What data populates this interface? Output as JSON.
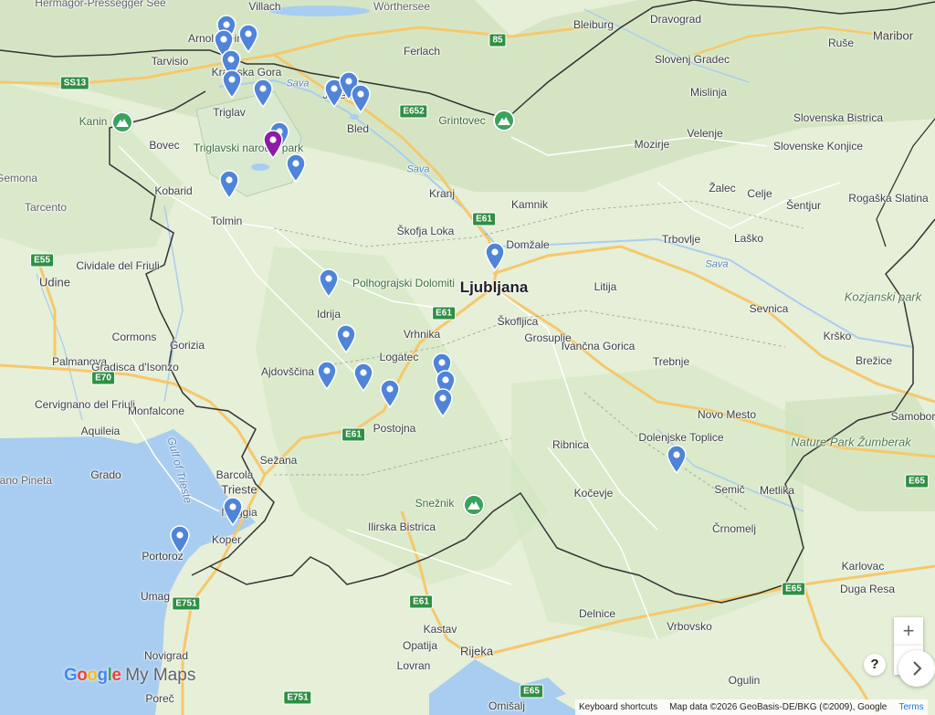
{
  "colors": {
    "land": "#e6efd8",
    "forest": "#cfe2bd",
    "water": "#a9cdf0",
    "park": "#d7ead0",
    "border": "#333333",
    "motorway": "#f6c86a",
    "road": "#ffffff",
    "pin": "#4f84d9",
    "pin_selected": "#8e1aa8",
    "peak_icon": "#3aa35b",
    "shield": "#2f8f43"
  },
  "labels": {
    "capital": "Ljubljana",
    "villach": "Villach",
    "worthersee_top": "Wörthersee",
    "hermagor": "Hermagor-Pressegger See",
    "worthersee_town": "Wörthersee",
    "arnoldstein": "Arnoldstein",
    "bleiburg": "Bleiburg",
    "dravograd": "Dravograd",
    "ferlach": "Ferlach",
    "rusa": "Ruše",
    "maribor": "Maribor",
    "tarvisio": "Tarvisio",
    "kranjska_gora": "Kranjska Gora",
    "slovenj_gradec": "Slovenj Gradec",
    "mislinja": "Mislinja",
    "jesenice": "Jesenice",
    "kanin": "Kanin",
    "triglav": "Triglav",
    "bled": "Bled",
    "grintovec": "Grintovec",
    "slovenska_bistrica": "Slovenska Bistrica",
    "velenje": "Velenje",
    "bovec": "Bovec",
    "triglav_park": "Triglavski narodni park",
    "mozirje": "Mozirje",
    "slovenske_konjice": "Slovenske Konjice",
    "semona": "Gemona",
    "kobarid": "Kobarid",
    "kranj": "Kranj",
    "kamnik": "Kamnik",
    "zalec": "Žalec",
    "celje": "Celje",
    "rogaska_slatina": "Rogaška Slatina",
    "sentjur": "Šentjur",
    "tarcento": "Tarcento",
    "tolmin": "Tolmin",
    "skofja_loka": "Škofja Loka",
    "domzale": "Domžale",
    "trbovlje": "Trbovlje",
    "lasko": "Laško",
    "cividale": "Cividale del Friuli",
    "udine": "Udine",
    "polhograjski": "Polhograjski Dolomiti",
    "litija": "Litija",
    "kozjanski": "Kozjanski park",
    "idrija": "Idrija",
    "sevnica": "Sevnica",
    "skofljica": "Škofljica",
    "cormons": "Cormons",
    "vrhnika": "Vrhnika",
    "grosuplje": "Grosuplje",
    "ivancna_gorica": "Ivančna Gorica",
    "krsko": "Krško",
    "palmanova": "Palmanova",
    "gorizia": "Gorizia",
    "gradisca": "Gradisca d'Isonzo",
    "logatec": "Logatec",
    "trebnje": "Trebnje",
    "brezice": "Brežice",
    "ajdovscina": "Ajdovščina",
    "cervignano": "Cervignano del Friuli",
    "monfalcone": "Monfalcone",
    "novo_mesto": "Novo Mesto",
    "samobor": "Samobor",
    "aquileia": "Aquileia",
    "nature_park": "Nature Park Žumberak",
    "postojna": "Postojna",
    "ribnica": "Ribnica",
    "dolenjske_toplice": "Dolenjske Toplice",
    "sezana": "Sežana",
    "gulf": "Gulf of Trieste",
    "grado": "Grado",
    "barcola": "Barcola",
    "lignano": "Lignano Pineta",
    "trieste": "Trieste",
    "kocevje": "Kočevje",
    "semic": "Semič",
    "metlika": "Metlika",
    "sneznik": "Snežnik",
    "muggia": "Muggia",
    "crnomelj": "Črnomelj",
    "ilirska_bistrica": "Ilirska Bistrica",
    "koper": "Koper",
    "portoroz": "Portorož",
    "karlovac": "Karlovac",
    "umag": "Umag",
    "duga_resa": "Duga Resa",
    "delnice": "Delnice",
    "kastav": "Kastav",
    "vrbovsko": "Vrbovsko",
    "opatija": "Opatija",
    "rijeka": "Rijeka",
    "novigrad": "Novigrad",
    "lovran": "Lovran",
    "ogulin": "Ogulin",
    "porec": "Poreč",
    "omisalj": "Omišalj",
    "sava1": "Sava",
    "sava2": "Sava",
    "sava3": "Sava"
  },
  "road_shields": {
    "a85": "85",
    "s13": "SS13",
    "e652": "E652",
    "e61_kranj": "E61",
    "e55": "E55",
    "e61_lj": "E61",
    "e70": "E70",
    "e61_postojna": "E61",
    "e751": "E751",
    "e61_south": "E61",
    "e65_croatia": "E65",
    "e65_far": "E65",
    "e65_bottom": "E65",
    "e751_bottom": "E751",
    "e65_right": "E65"
  },
  "pins": [
    {
      "name": "Kranjska Gora area 1",
      "selected": false
    },
    {
      "name": "Kranjska Gora area 2",
      "selected": false
    },
    {
      "name": "Kranjska Gora area 3",
      "selected": false
    },
    {
      "name": "Vršič",
      "selected": false
    },
    {
      "name": "Trenta",
      "selected": false
    },
    {
      "name": "Pokljuka",
      "selected": false
    },
    {
      "name": "Jesenice",
      "selected": false
    },
    {
      "name": "Bled east",
      "selected": false
    },
    {
      "name": "Bled",
      "selected": false
    },
    {
      "name": "Bohinj",
      "selected": false
    },
    {
      "name": "Bohinj lake",
      "selected": true
    },
    {
      "name": "Savica",
      "selected": false
    },
    {
      "name": "Tolmin gorge",
      "selected": false
    },
    {
      "name": "Ljubljana",
      "selected": false
    },
    {
      "name": "Idrija",
      "selected": false
    },
    {
      "name": "Godovič",
      "selected": false
    },
    {
      "name": "Vipava",
      "selected": false
    },
    {
      "name": "Predjama",
      "selected": false
    },
    {
      "name": "Postojna Cave",
      "selected": false
    },
    {
      "name": "Planina",
      "selected": false
    },
    {
      "name": "Rakov Škocjan",
      "selected": false
    },
    {
      "name": "Cerknica Lake",
      "selected": false
    },
    {
      "name": "Kočevski Rog",
      "selected": false
    },
    {
      "name": "Koper",
      "selected": false
    },
    {
      "name": "Piran",
      "selected": false
    }
  ],
  "peaks": [
    {
      "name": "Kanin"
    },
    {
      "name": "Grintovec"
    },
    {
      "name": "Snežnik"
    }
  ],
  "controls": {
    "zoom_in": "+",
    "zoom_out": "−",
    "help": "?"
  },
  "branding": {
    "google": "Google",
    "my_maps": "My Maps"
  },
  "footer": {
    "keyboard_shortcuts": "Keyboard shortcuts",
    "map_data": "Map data ©2026 GeoBasis-DE/BKG (©2009), Google",
    "terms": "Terms"
  }
}
